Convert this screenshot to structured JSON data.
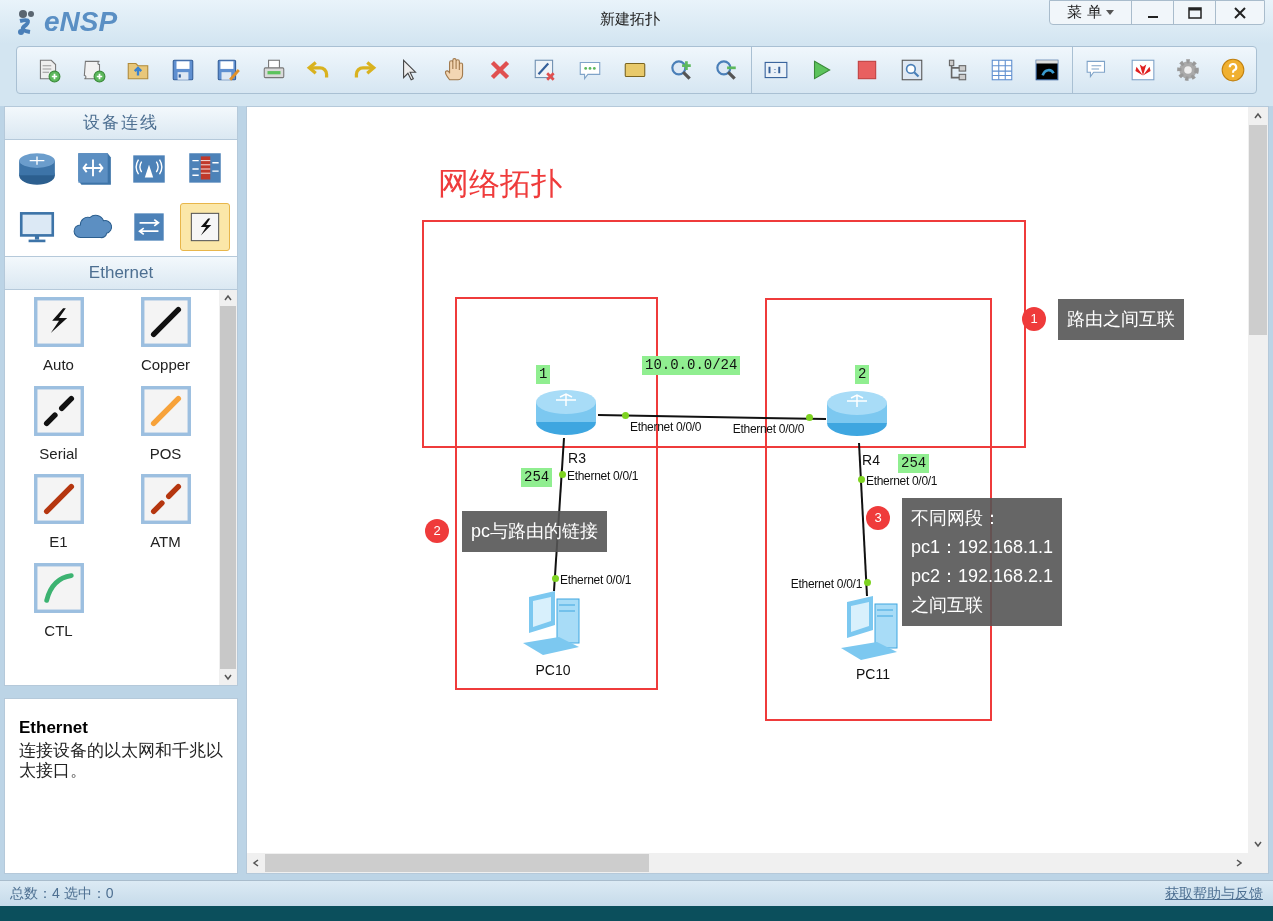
{
  "window": {
    "app_name": "eNSP",
    "title": "新建拓扑",
    "menu_button": "菜 单"
  },
  "device_panel": {
    "title": "设备连线",
    "categories": [
      {
        "kind": "router",
        "selected": false
      },
      {
        "kind": "switch",
        "selected": false
      },
      {
        "kind": "wireless",
        "selected": false
      },
      {
        "kind": "firewall",
        "selected": false
      },
      {
        "kind": "pc",
        "selected": false
      },
      {
        "kind": "cloud",
        "selected": false
      },
      {
        "kind": "other",
        "selected": false
      },
      {
        "kind": "cable",
        "selected": true
      }
    ]
  },
  "cable_panel": {
    "title": "Ethernet",
    "cables": [
      {
        "label": "Auto",
        "kind": "auto"
      },
      {
        "label": "Copper",
        "kind": "copper"
      },
      {
        "label": "Serial",
        "kind": "serial"
      },
      {
        "label": "POS",
        "kind": "pos"
      },
      {
        "label": "E1",
        "kind": "e1"
      },
      {
        "label": "ATM",
        "kind": "atm"
      },
      {
        "label": "CTL",
        "kind": "ctl"
      }
    ]
  },
  "description": {
    "title": "Ethernet",
    "text": "连接设备的以太网和千兆以太接口。"
  },
  "canvas": {
    "title": "网络拓扑",
    "nodes": [
      {
        "label": "R3",
        "kind": "router"
      },
      {
        "label": "R4",
        "kind": "router"
      },
      {
        "label": "PC10",
        "kind": "pc"
      },
      {
        "label": "PC11",
        "kind": "pc"
      }
    ],
    "ports": [
      "Ethernet 0/0/0",
      "Ethernet 0/0/0",
      "Ethernet 0/0/1",
      "Ethernet 0/0/1",
      "Ethernet 0/0/1",
      "Ethernet 0/0/1"
    ],
    "tags": [
      "1",
      "10.0.0.0/24",
      "2",
      "254",
      "254"
    ],
    "callouts": [
      {
        "number": "1",
        "lines": [
          "路由之间互联"
        ]
      },
      {
        "number": "2",
        "lines": [
          "pc与路由的链接"
        ]
      },
      {
        "number": "3",
        "lines": [
          "不同网段：",
          "pc1：192.168.1.1",
          "pc2：192.168.2.1",
          "之间互联"
        ]
      }
    ]
  },
  "status_bar": {
    "summary": "总数：4 选中：0",
    "help_link": "获取帮助与反馈"
  }
}
